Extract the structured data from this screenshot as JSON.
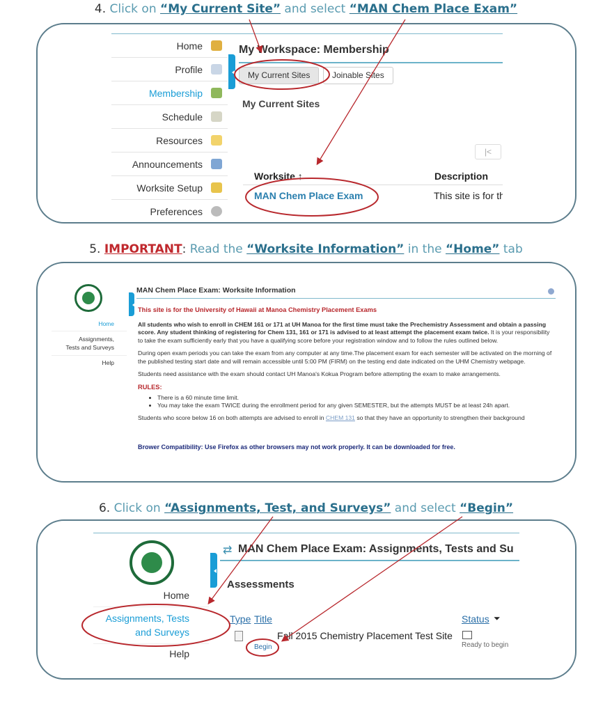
{
  "steps": [
    {
      "num": "4.",
      "pre": "Click on ",
      "a": "“My Current Site”",
      "mid": " and select ",
      "b": "“MAN Chem Place Exam”"
    },
    {
      "num": "5.",
      "imp": "IMPORTANT",
      "colon": ":",
      "pre": " Read the ",
      "a": "“Worksite Information”",
      "mid": " in the ",
      "b": "“Home”",
      "post": " tab"
    },
    {
      "num": "6.",
      "pre": "Click on ",
      "a": "“Assignments, Test, and Surveys”",
      "mid": " and select ",
      "b": "“Begin”"
    }
  ],
  "panel1": {
    "sidebar": [
      "Home",
      "Profile",
      "Membership",
      "Schedule",
      "Resources",
      "Announcements",
      "Worksite Setup",
      "Preferences"
    ],
    "title": "My Workspace: Membership",
    "tabs": [
      "My Current Sites",
      "Joinable Sites"
    ],
    "subtitle": "My Current Sites",
    "pager_first": "|<",
    "columns": [
      "Worksite ↑",
      "Description"
    ],
    "row": {
      "worksite": "MAN Chem Place Exam",
      "description": "This site is for th"
    }
  },
  "panel2": {
    "sidebar": [
      "Home",
      "Assignments, Tests and Surveys",
      "Help"
    ],
    "title": "MAN Chem Place Exam: Worksite Information",
    "heading": "This site is for the University of Hawaii at Manoa Chemistry Placement Exams",
    "para1_bold": "All students who wish to enroll in CHEM 161 or 171 at UH Manoa for the first time must take the Prechemistry Assessment and obtain a passing score. Any student thinking of registering for Chem 131, 161 or 171 is advised to at least attempt the placement exam twice.",
    "para1_rest": " It is your responsibility to take the exam sufficiently early that you have a qualifying score before your registration window and to follow the rules outlined below.",
    "para2": "During open exam periods you can take the exam from any computer at any time.The placement exam for each semester will be activated on the morning of the published testing start date and will remain accessible until 5:00 PM (FIRM) on the testing end date indicated on the UHM Chemistry webpage.",
    "para3": "Students need assistance with the exam should contact UH Manoa's Kokua Program before attempting the exam to make arrangements.",
    "rules_label": "RULES:",
    "rules": [
      "There is a 60 minute time limit.",
      "You may take the exam TWICE during the enrollment period for any given SEMESTER, but the attempts MUST be at least 24h apart."
    ],
    "para4_pre": "Students who score below 16 on both attempts are advised to enroll in ",
    "para4_link": "CHEM 131",
    "para4_post": " so that they have an opportunity to strengthen their background",
    "compat": "Brower Compatibility: Use Firefox as other browsers may not work properly. It can be downloaded for free."
  },
  "panel3": {
    "sidebar": [
      "Home",
      "Assignments, Tests",
      "and Surveys",
      "Help"
    ],
    "title": "MAN Chem Place Exam: Assignments, Tests and Su",
    "subtitle": "Assessments",
    "columns": [
      "Type",
      "Title",
      "Status"
    ],
    "row": {
      "title": "Fall 2015 Chemistry Placement Test Site",
      "action": "Begin",
      "status": "Ready to begin"
    }
  },
  "colors": {
    "accent": "#1a9dd6",
    "highlight": "#c0282d",
    "border": "#5c7d8c"
  }
}
